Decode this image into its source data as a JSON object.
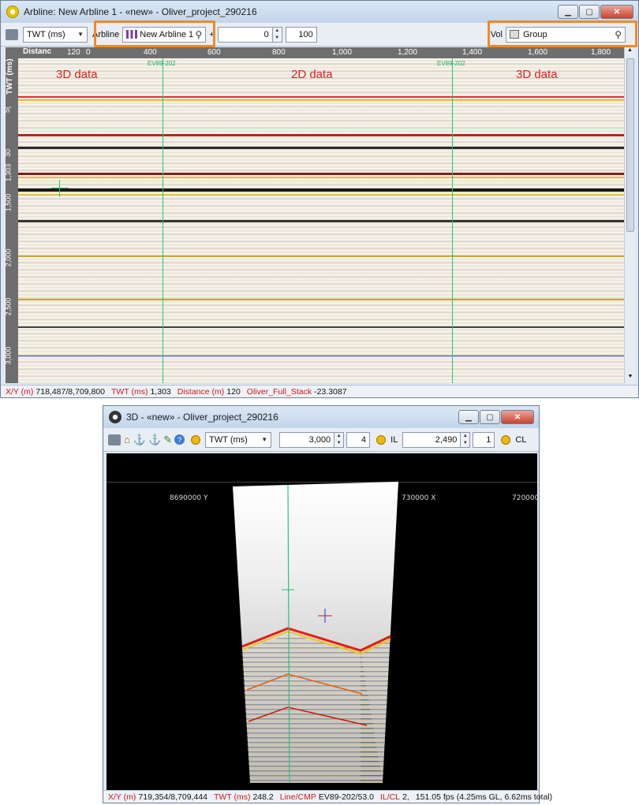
{
  "arbline": {
    "title": "Arbline: New Arbline 1 - «new» - Oliver_project_290216",
    "domain_select": "TWT (ms)",
    "arbline_label": "Arbline",
    "arbline_value": "New Arbline 1",
    "start_value": "0",
    "end_value": "100",
    "vol_label": "Vol",
    "vol_value": "Group",
    "distance_label": "Distanc",
    "twt_label": "TWT (ms)",
    "distance_ticks": [
      "120",
      "0",
      "400",
      "600",
      "800",
      "1,000",
      "1,200",
      "1,400",
      "1,600",
      "1,800"
    ],
    "twt_ticks": [
      "5(",
      "30",
      "1,303",
      "1,500",
      "2,000",
      "2,500",
      "3,000"
    ],
    "well_labels": [
      "EV89-202",
      "EV89-202"
    ],
    "overlay_labels": [
      "3D data",
      "2D data",
      "3D data"
    ],
    "status": [
      {
        "key": "X/Y (m)",
        "value": "718,487/8,709,800"
      },
      {
        "key": "TWT (ms)",
        "value": "1,303"
      },
      {
        "key": "Distance (m)",
        "value": "120"
      },
      {
        "key": "Oliver_Full_Stack",
        "value": "-23.3087"
      }
    ]
  },
  "view3d": {
    "title": "3D - «new» - Oliver_project_290216",
    "domain_select": "TWT (ms)",
    "time_value": "3,000",
    "time_step": "4",
    "il_label": "IL",
    "il_value": "2,490",
    "il_step": "1",
    "cl_label": "CL",
    "coord_labels": [
      "8690000 Y",
      "730000 X",
      "720000"
    ],
    "status": [
      {
        "key": "X/Y (m)",
        "value": "719,354/8,709,444"
      },
      {
        "key": "TWT (ms)",
        "value": "248.2"
      },
      {
        "key": "Line/CMP",
        "value": "EV89-202/53.0"
      },
      {
        "key": "IL/CL",
        "value": "2,"
      },
      {
        "key": "",
        "value": "151.05 fps (4.25ms GL, 6.62ms total)"
      }
    ]
  },
  "colors": {
    "highlight": "#f08a24",
    "status_key": "#d01818",
    "well_line": "#27c27a",
    "horizon_blue": "#2233cc"
  }
}
